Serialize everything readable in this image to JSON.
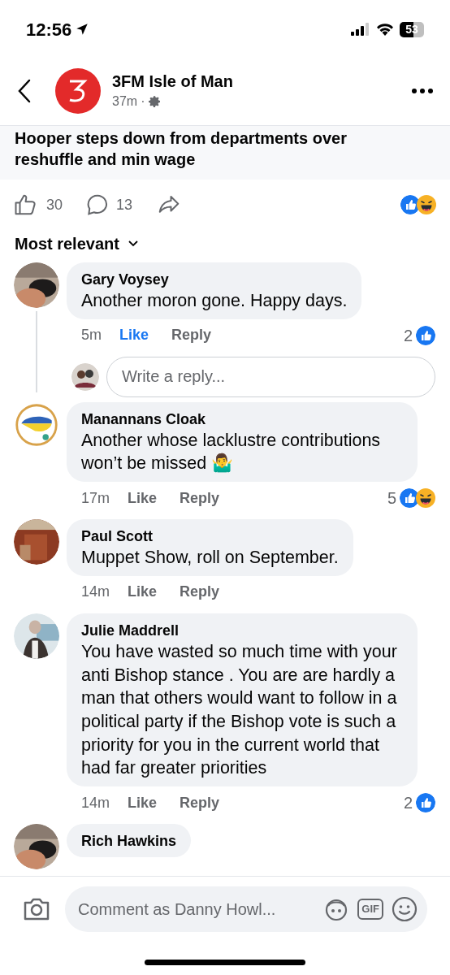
{
  "status_bar": {
    "time": "12:56",
    "battery": "53"
  },
  "header": {
    "page_name": "3FM Isle of Man",
    "time": "37m",
    "separator": "·"
  },
  "post": {
    "title": "Hooper steps down from departments over reshuffle and min wage"
  },
  "actions": {
    "likes": "30",
    "comments": "13",
    "reactions": [
      {
        "kind": "like"
      },
      {
        "kind": "haha"
      }
    ]
  },
  "sort": {
    "label": "Most relevant"
  },
  "comments": [
    {
      "author": "Gary Voysey",
      "text": "Another moron gone. Happy days.",
      "time": "5m",
      "like_label": "Like",
      "reply_label": "Reply",
      "liked": true,
      "reaction_count": "2",
      "reactions": [
        {
          "kind": "like"
        }
      ],
      "reply_box": {
        "placeholder": "Write a reply..."
      }
    },
    {
      "author": "Manannans Cloak",
      "text": "Another whose lacklustre contributions won’t be missed 🤷‍♂️",
      "time": "17m",
      "like_label": "Like",
      "reply_label": "Reply",
      "liked": false,
      "reaction_count": "5",
      "reactions": [
        {
          "kind": "like"
        },
        {
          "kind": "haha"
        }
      ]
    },
    {
      "author": "Paul Scott",
      "text": "Muppet Show, roll on September.",
      "time": "14m",
      "like_label": "Like",
      "reply_label": "Reply",
      "liked": false
    },
    {
      "author": "Julie Maddrell",
      "text": "You have wasted so much time with your anti Bishop stance . You are are hardly a man that others would want to follow in a political party if the Bishop vote is such a priority for you in the current world that had far greater priorities",
      "time": "14m",
      "like_label": "Like",
      "reply_label": "Reply",
      "liked": false,
      "reaction_count": "2",
      "reactions": [
        {
          "kind": "like"
        }
      ]
    },
    {
      "author": "Rich Hawkins"
    }
  ],
  "composer": {
    "placeholder": "Comment as Danny Howl...",
    "gif_label": "GIF"
  }
}
